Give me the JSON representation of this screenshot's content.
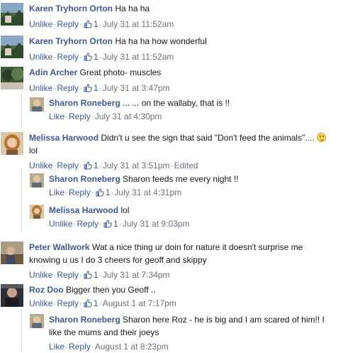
{
  "labels": {
    "unlike": "Unlike",
    "like": "Like",
    "reply": "Reply",
    "edited": "Edited"
  },
  "comments": [
    {
      "author": "Karen Tryhorn Orton",
      "text": "Ha ha ha",
      "likes": "1",
      "time": "July 31 at 11:52am"
    },
    {
      "author": "Karen Tryhorn Orton",
      "text": "Ha ha ha how wonderful",
      "likes": "1",
      "time": "July 31 at 11:52am"
    },
    {
      "author": "Adin Archer",
      "text": "Great photo- muscles",
      "likes": "1",
      "time": "July 31 at 3:47pm"
    },
    {
      "author": "Sharon Roneberg",
      "text": "... ... on the wallaby, that is !!",
      "time": "July 31 at 4:30pm"
    },
    {
      "author": "Melissa Harwood",
      "text": "Didn't u see the sign that said \"Don't feed the animals\"....",
      "text2": "lol",
      "likes": "1",
      "time": "July 31 at 3:51pm"
    },
    {
      "author": "Sharon Roneberg",
      "text": "Sharon feeds me every night !!",
      "likes": "1",
      "time": "July 31 at 4:31pm"
    },
    {
      "author": "Melissa Harwood",
      "text": "lol",
      "likes": "1",
      "time": "July 31 at 9:03pm"
    },
    {
      "author": "Peter Wallwork",
      "text": "Wat a nice thing ur doin for nature it doesn't surprise me",
      "text2": "knowing u us I do 3 cheers for geoff and skippy",
      "likes": "1",
      "time": "July 31 at 7:34pm"
    },
    {
      "author": "Roz Doo",
      "text": "Bigger then you Geoff ..",
      "likes": "1",
      "time": "August 1 at 7:17pm"
    },
    {
      "author": "Sharon Roneberg",
      "text": "Sharon here Roz - he is big and I am scared of him!! I",
      "text2": "like the mums and their joeys",
      "time": "August 1 at 8:23pm"
    }
  ]
}
